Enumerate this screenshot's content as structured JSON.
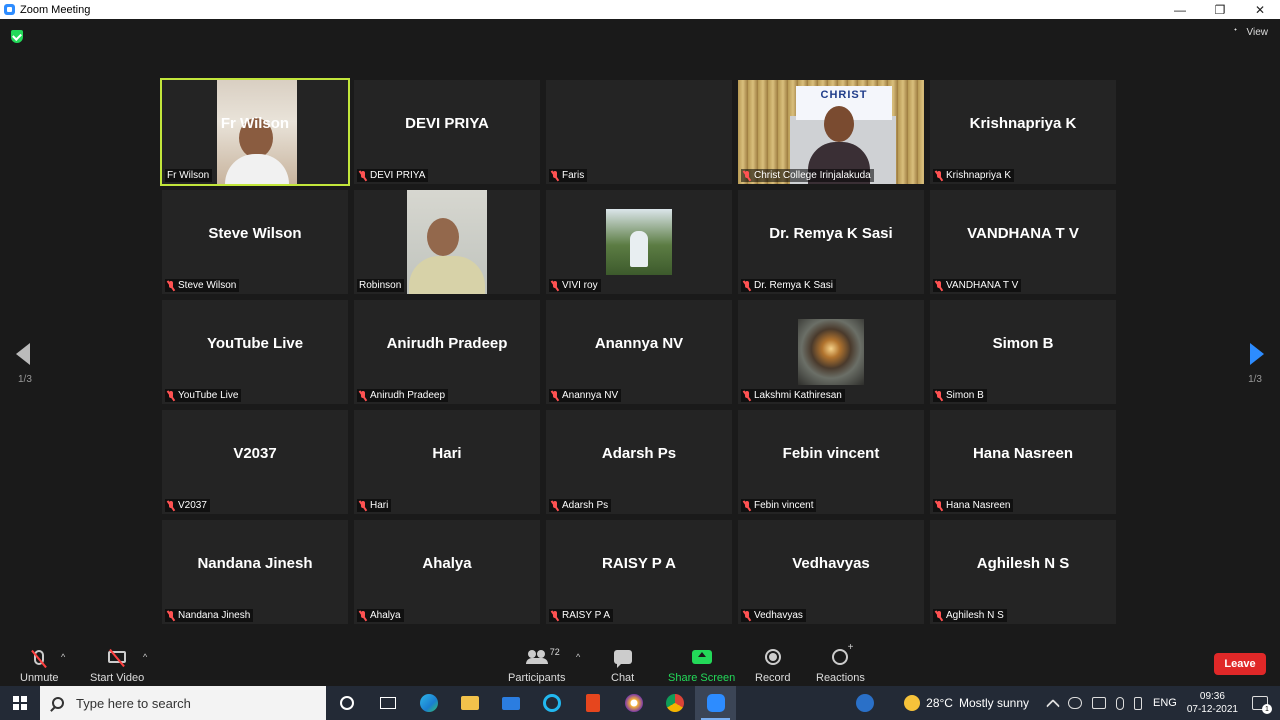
{
  "window": {
    "title": "Zoom Meeting",
    "minimize_glyph": "—",
    "maximize_glyph": "❐",
    "close_glyph": "✕"
  },
  "meeting": {
    "view_label": "View",
    "page_left": "1/3",
    "page_right": "1/3",
    "participants": [
      {
        "name": "Fr Wilson",
        "label": "Fr Wilson",
        "video": "fr-wilson",
        "muted": false,
        "active_speaker": true
      },
      {
        "name": "DEVI PRIYA",
        "label": "DEVI PRIYA",
        "video": null,
        "muted": true
      },
      {
        "name": "",
        "label": "Faris",
        "video": null,
        "muted": true
      },
      {
        "name": "",
        "label": "Christ College Irinjalakuda",
        "video": "christ",
        "muted": true,
        "banner_text": "CHRIST"
      },
      {
        "name": "Krishnapriya K",
        "label": "Krishnapriya K",
        "video": null,
        "muted": true
      },
      {
        "name": "Steve Wilson",
        "label": "Steve Wilson",
        "video": null,
        "muted": true
      },
      {
        "name": "",
        "label": "Robinson",
        "video": "robinson",
        "muted": false
      },
      {
        "name": "",
        "label": "VIVI roy",
        "video": "vivi",
        "muted": true
      },
      {
        "name": "Dr. Remya K Sasi",
        "label": "Dr. Remya K Sasi",
        "video": null,
        "muted": true
      },
      {
        "name": "VANDHANA T V",
        "label": "VANDHANA T V",
        "video": null,
        "muted": true
      },
      {
        "name": "YouTube Live",
        "label": "YouTube Live",
        "video": null,
        "muted": true
      },
      {
        "name": "Anirudh Pradeep",
        "label": "Anirudh Pradeep",
        "video": null,
        "muted": true
      },
      {
        "name": "Anannya NV",
        "label": "Anannya NV",
        "video": null,
        "muted": true
      },
      {
        "name": "",
        "label": "Lakshmi Kathiresan",
        "video": "lakshmi",
        "muted": true
      },
      {
        "name": "Simon B",
        "label": "Simon B",
        "video": null,
        "muted": true
      },
      {
        "name": "V2037",
        "label": "V2037",
        "video": null,
        "muted": true
      },
      {
        "name": "Hari",
        "label": "Hari",
        "video": null,
        "muted": true
      },
      {
        "name": "Adarsh Ps",
        "label": "Adarsh Ps",
        "video": null,
        "muted": true
      },
      {
        "name": "Febin vincent",
        "label": "Febin vincent",
        "video": null,
        "muted": true
      },
      {
        "name": "Hana Nasreen",
        "label": "Hana Nasreen",
        "video": null,
        "muted": true
      },
      {
        "name": "Nandana Jinesh",
        "label": "Nandana Jinesh",
        "video": null,
        "muted": true
      },
      {
        "name": "Ahalya",
        "label": "Ahalya",
        "video": null,
        "muted": true
      },
      {
        "name": "RAISY P A",
        "label": "RAISY P A",
        "video": null,
        "muted": true
      },
      {
        "name": "Vedhavyas",
        "label": "Vedhavyas",
        "video": null,
        "muted": true
      },
      {
        "name": "Aghilesh N S",
        "label": "Aghilesh N S",
        "video": null,
        "muted": true
      }
    ]
  },
  "controls": {
    "unmute": "Unmute",
    "start_video": "Start Video",
    "participants": "Participants",
    "participants_count": "72",
    "chat": "Chat",
    "share_screen": "Share Screen",
    "record": "Record",
    "reactions": "Reactions",
    "leave": "Leave",
    "caret": "^"
  },
  "taskbar": {
    "search_placeholder": "Type here to search",
    "weather_temp": "28°C",
    "weather_desc": "Mostly sunny",
    "language": "ENG",
    "time": "09:36",
    "date": "07-12-2021",
    "notification_count": "1"
  },
  "colors": {
    "accent_blue": "#2d8cff",
    "share_green": "#23d959",
    "leave_red": "#e02828",
    "active_speaker": "#c2e63b",
    "muted_red": "#ff5252"
  }
}
